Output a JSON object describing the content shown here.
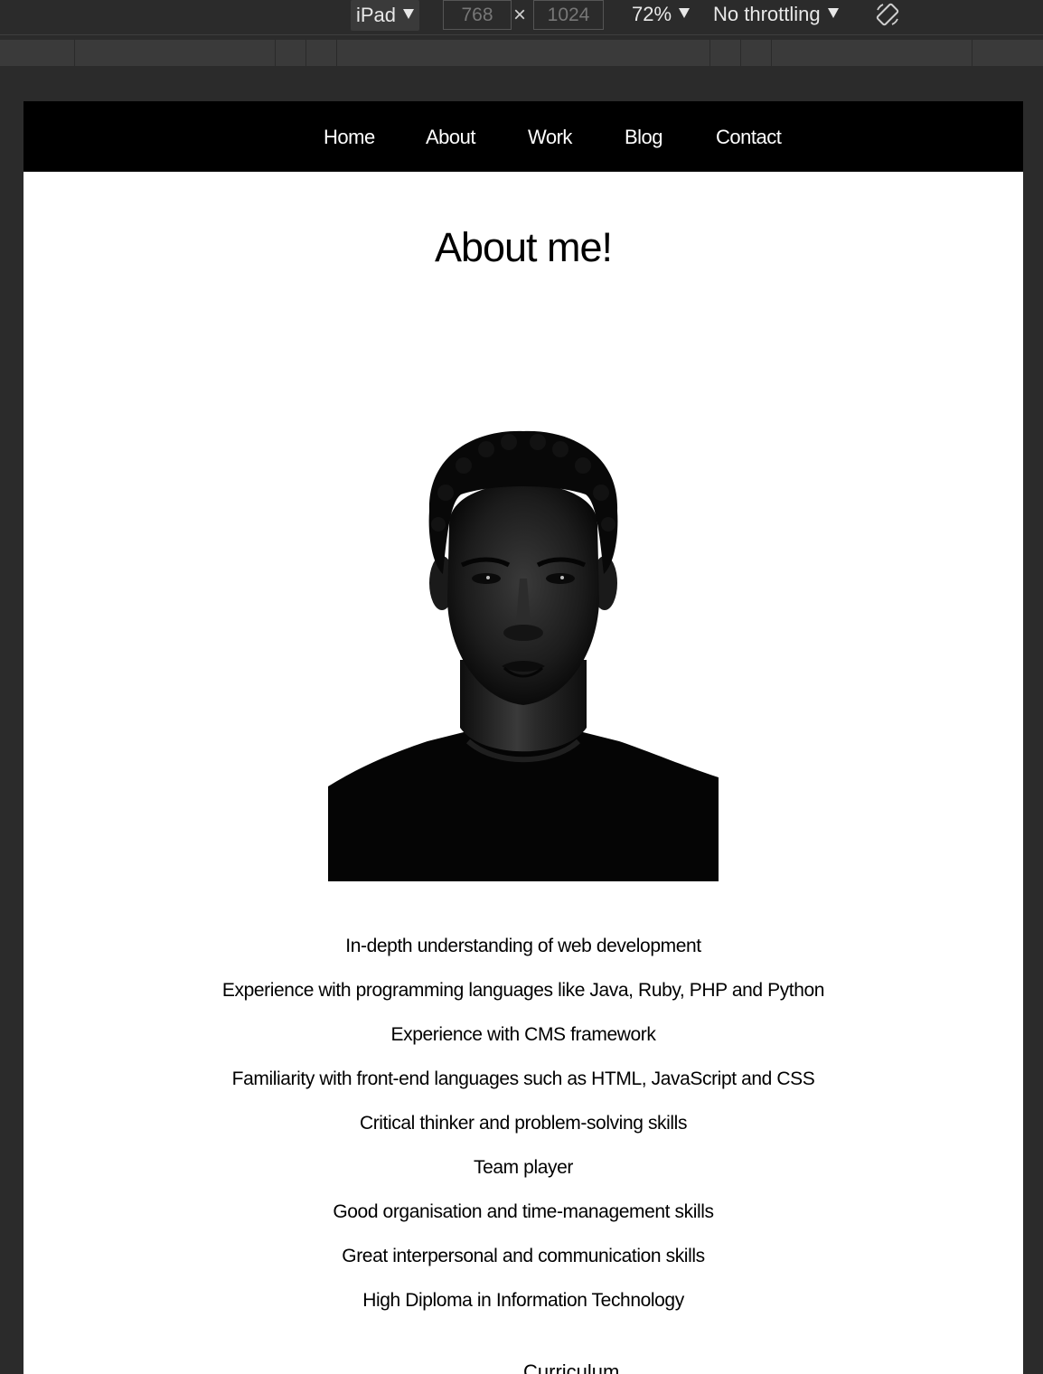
{
  "devtools": {
    "device": "iPad",
    "width": "768",
    "height": "1024",
    "dimension_separator": "×",
    "zoom": "72%",
    "throttling": "No throttling"
  },
  "nav": {
    "items": [
      {
        "label": "Home"
      },
      {
        "label": "About"
      },
      {
        "label": "Work"
      },
      {
        "label": "Blog"
      },
      {
        "label": "Contact"
      }
    ]
  },
  "page": {
    "title": "About me!",
    "skills": [
      "In-depth understanding of web development",
      "Experience with programming languages like Java, Ruby, PHP and Python",
      "Experience with CMS framework",
      "Familiarity with front-end languages such as HTML, JavaScript and CSS",
      "Critical thinker and problem-solving skills",
      "Team player",
      "Good organisation and time-management skills",
      "Great interpersonal and communication skills",
      "High Diploma in Information Technology"
    ],
    "cv_link": "Curriculum"
  },
  "colors": {
    "devtools_bg": "#2b2b2b",
    "nav_bg": "#000000",
    "page_bg": "#ffffff"
  }
}
